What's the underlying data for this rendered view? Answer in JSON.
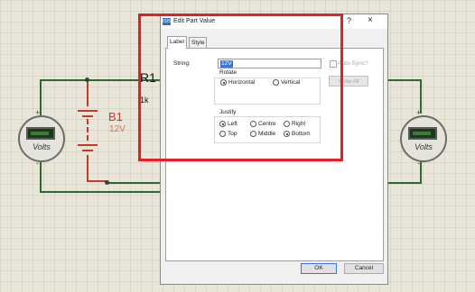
{
  "schematic": {
    "resistor_label": "R1",
    "resistor_value_partial": "1k",
    "battery_label": "B1",
    "battery_value": "12V",
    "left_meter_caption": "Volts",
    "right_meter_caption": "Volts",
    "plus_sign": "+",
    "minus_sign": "-"
  },
  "dialog": {
    "title": "Edit Part Value",
    "app_icon_text": "ISIS",
    "help_symbol": "?",
    "close_symbol": "×",
    "tabs": [
      "Label",
      "Style"
    ],
    "string_label": "String:",
    "string_value": "12V",
    "auto_sync_label": "Auto-Sync?",
    "show_all_label": "Show All",
    "rotate": {
      "heading": "Rotate",
      "options": [
        "Horizontal",
        "Vertical"
      ],
      "selected": "Horizontal"
    },
    "justify": {
      "heading": "Justify",
      "options": [
        "Left",
        "Centre",
        "Right",
        "Top",
        "Middle",
        "Bottom"
      ],
      "selected": [
        "Left",
        "Bottom"
      ]
    },
    "ok_label": "OK",
    "cancel_label": "Cancel"
  },
  "colors": {
    "highlight_box": "#e3202a",
    "wire": "#2d6b2d",
    "battery_wire": "#c43a2a",
    "selection": "#3a78d4"
  }
}
